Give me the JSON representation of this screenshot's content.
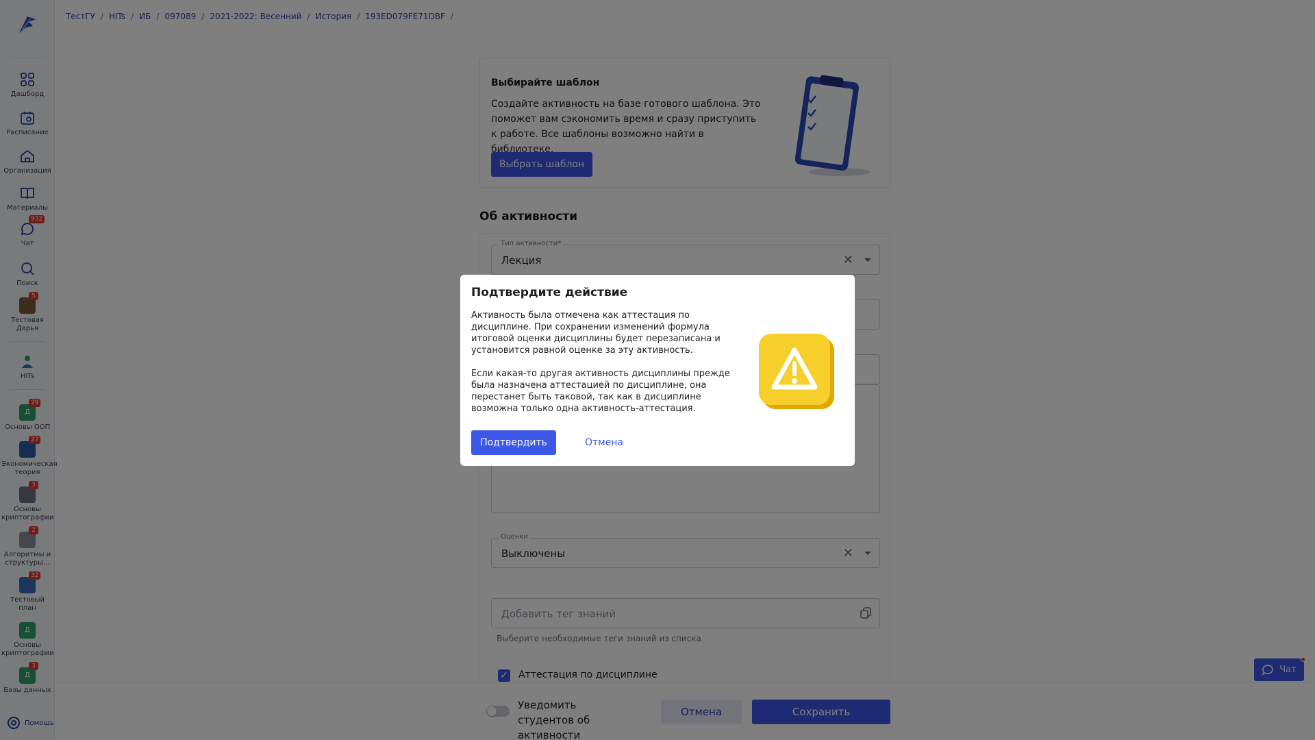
{
  "breadcrumb": [
    "ТестГУ",
    "HITs",
    "ИБ",
    "097089",
    "2021-2022: Весенний",
    "История",
    "193ED079FE71DBF"
  ],
  "sidebar": {
    "items": [
      {
        "label": "Дашборд",
        "icon": "dashboard-icon"
      },
      {
        "label": "Расписание",
        "icon": "calendar-icon"
      },
      {
        "label": "Организация",
        "icon": "home-icon"
      },
      {
        "label": "Материалы",
        "icon": "book-icon"
      },
      {
        "label": "Чат",
        "icon": "chat-icon",
        "badge": "932"
      },
      {
        "label": "Поиск",
        "icon": "search-icon"
      },
      {
        "label": "Тестовая Дарья",
        "icon": "avatar",
        "badge": "5"
      }
    ],
    "org": {
      "label": "HITs"
    },
    "courses": [
      {
        "label": "Основы ООП",
        "badge": "29",
        "initial": "Д",
        "color": "#2e9e6a"
      },
      {
        "label": "Экономическая теория",
        "badge": "27",
        "initial": "",
        "color": "#2b5fa8"
      },
      {
        "label": "Основы криптографии",
        "badge": "3",
        "initial": "",
        "color": "#6b7080"
      },
      {
        "label": "Алгоритмы и структуры...",
        "badge": "2",
        "initial": "",
        "color": "#8a8f9c"
      },
      {
        "label": "Тестовый план",
        "badge": "32",
        "initial": "",
        "color": "#3a6db8"
      },
      {
        "label": "Основы криптографии",
        "badge": "",
        "initial": "Д",
        "color": "#2e9e6a"
      },
      {
        "label": "Базы данных",
        "badge": "3",
        "initial": "Д",
        "color": "#2e9e6a"
      }
    ],
    "help_label": "Помощь"
  },
  "template_card": {
    "title": "Выбирайте шаблон",
    "text": "Создайте активность на базе готового шаблона. Это поможет вам сэкономить время и сразу приступить к работе. Все шаблоны возможно найти в библиотеке.",
    "button": "Выбрать шаблон"
  },
  "about": {
    "title": "Об активности",
    "type_label": "Тип активности*",
    "type_value": "Лекция",
    "grades_label": "Оценки",
    "grades_value": "Выключены",
    "tag_placeholder": "Добавить тег знаний",
    "tag_hint": "Выберите необходимые теги знаний из списка",
    "attestation_label": "Аттестация по дисциплине"
  },
  "bottom_bar": {
    "notify_label": "Уведомить студентов об активности",
    "cancel": "Отмена",
    "save": "Сохранить"
  },
  "chat_button": "Чат",
  "modal": {
    "title": "Подтвердите действие",
    "paragraph1": "Активность была отмечена как аттестация по дисциплине. При сохранении изменений формула итоговой оценки дисциплины будет перезаписана и установится равной оценке за эту активность.",
    "paragraph2": "Если какая-то другая активность дисциплины прежде была назначена аттестацией по дисциплине, она перестанет быть таковой, так как в дисциплине возможна только одна активность-аттестация.",
    "confirm": "Подтвердить",
    "cancel": "Отмена"
  },
  "colors": {
    "accent": "#3d57e6",
    "badge": "#e53935",
    "warning": "#f5c518"
  }
}
